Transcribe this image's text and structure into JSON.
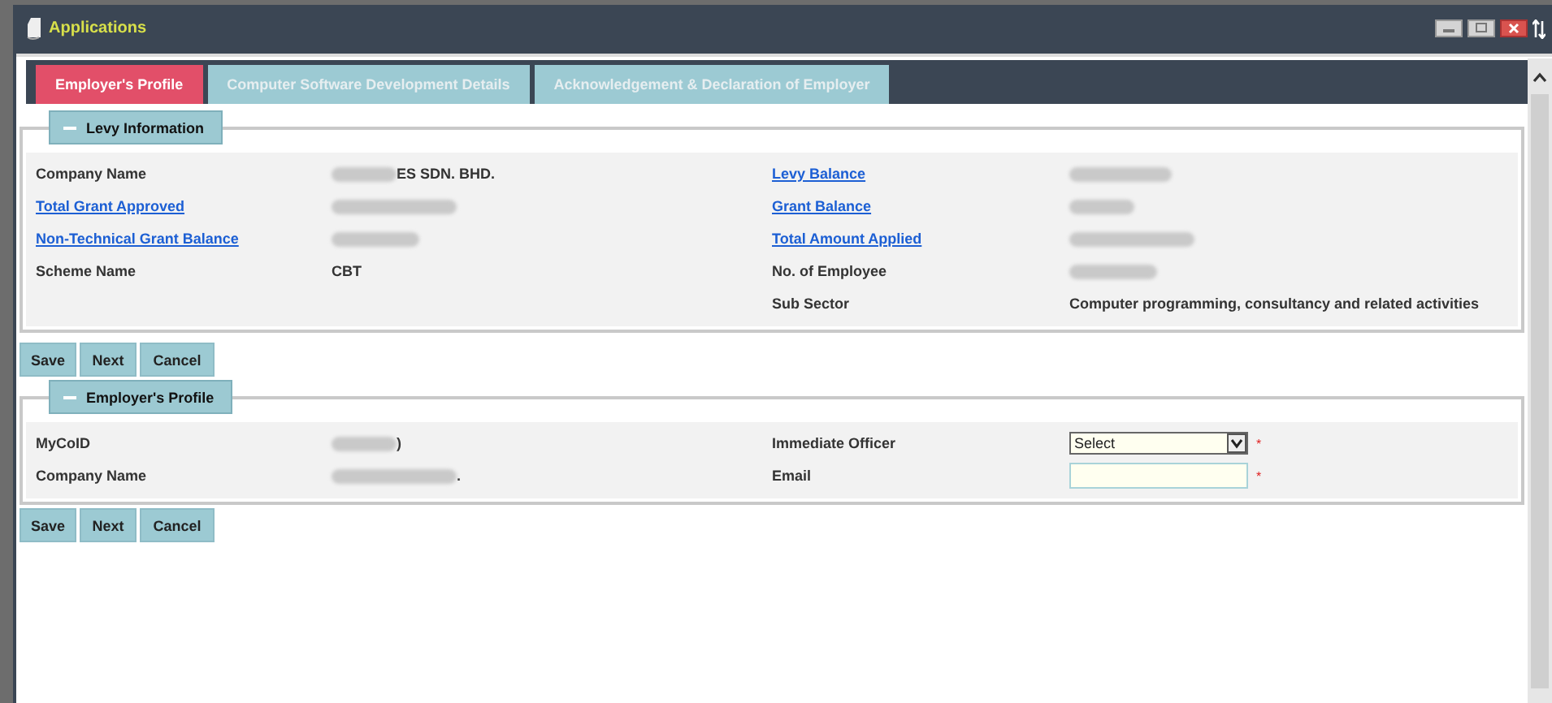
{
  "window": {
    "title": "Applications"
  },
  "tabs": [
    {
      "label": "Employer's Profile",
      "selected": true
    },
    {
      "label": "Computer Software Development Details",
      "selected": false
    },
    {
      "label": "Acknowledgement & Declaration of Employer",
      "selected": false
    }
  ],
  "levy_information": {
    "title": "Levy Information",
    "expanded": true,
    "left": [
      {
        "label": "Company Name",
        "link": false,
        "kind": "redacted",
        "value": "ES SDN. BHD."
      },
      {
        "label": "Total Grant Approved",
        "link": true,
        "kind": "redacted"
      },
      {
        "label": "Non-Technical Grant Balance",
        "link": true,
        "kind": "redacted"
      },
      {
        "label": "Scheme Name",
        "link": false,
        "kind": "text",
        "value": "CBT"
      }
    ],
    "right": [
      {
        "label": "Levy Balance",
        "link": true,
        "kind": "redacted"
      },
      {
        "label": "Grant Balance",
        "link": true,
        "kind": "redacted"
      },
      {
        "label": "Total Amount Applied",
        "link": true,
        "kind": "redacted"
      },
      {
        "label": "No. of Employee",
        "link": false,
        "kind": "redacted"
      },
      {
        "label": "Sub Sector",
        "link": false,
        "kind": "text",
        "value": "Computer programming, consultancy and related activities"
      }
    ]
  },
  "buttons_1": [
    "Save",
    "Next",
    "Cancel"
  ],
  "employer_profile": {
    "title": "Employer's Profile",
    "expanded": true,
    "left": [
      {
        "label": "MyCoID",
        "link": false,
        "kind": "redacted",
        "value": ")"
      },
      {
        "label": "Company Name",
        "link": false,
        "kind": "redacted",
        "value": "."
      }
    ],
    "right": [
      {
        "label": "Immediate Officer",
        "kind": "select",
        "value": "Select",
        "required_mark": "*"
      },
      {
        "label": "Email",
        "kind": "input",
        "required_mark": "*"
      }
    ]
  },
  "buttons_2": [
    "Save",
    "Next",
    "Cancel"
  ]
}
